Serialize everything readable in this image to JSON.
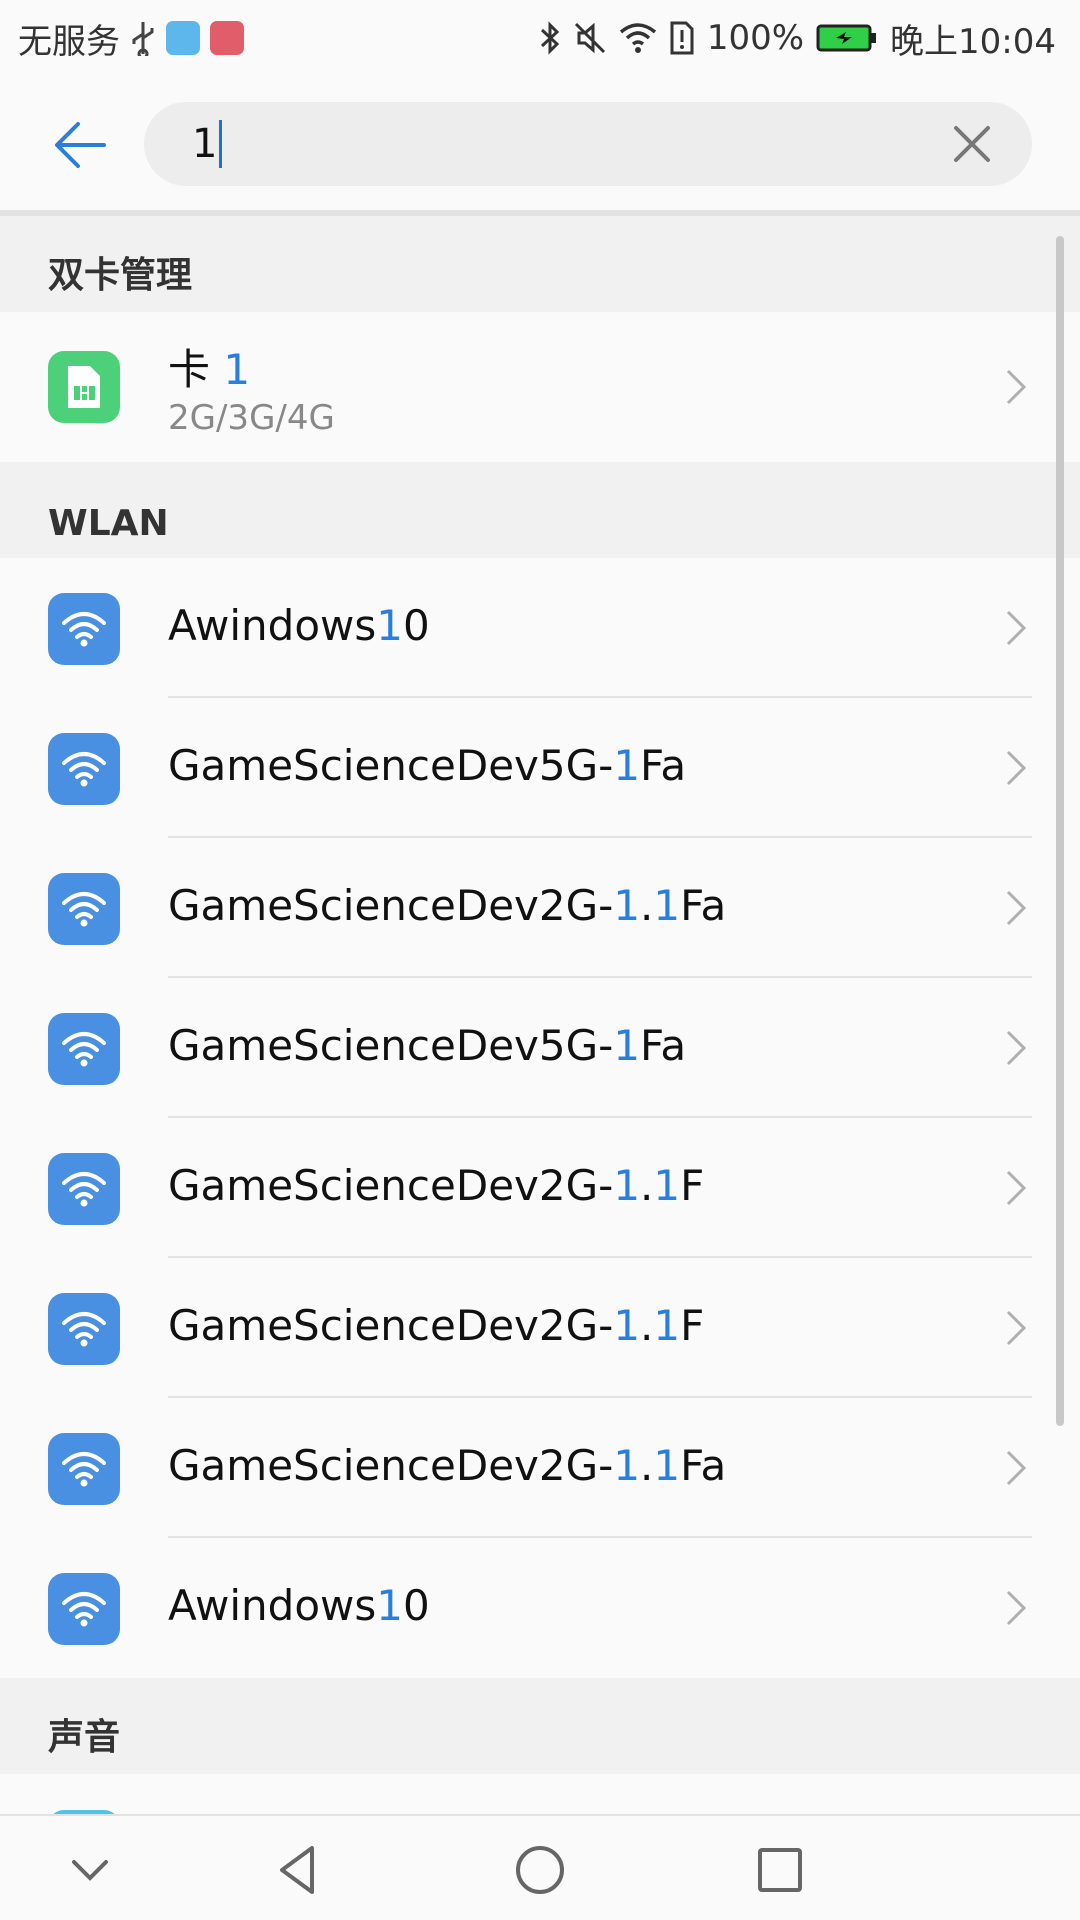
{
  "status_bar": {
    "carrier": "无服务",
    "battery_percent": "100%",
    "time": "晚上10:04",
    "icons": [
      "usb-icon",
      "app-icon-blue",
      "app-icon-red",
      "bluetooth-icon",
      "mute-icon",
      "wifi-icon",
      "sim-alert-icon",
      "battery-charging-icon"
    ]
  },
  "search": {
    "query": "1",
    "back_icon": "arrow-left-icon",
    "clear_icon": "close-icon"
  },
  "sections": {
    "dual_sim": {
      "title": "双卡管理",
      "items": [
        {
          "title_prefix": "卡 ",
          "title_match": "1",
          "subtitle": "2G/3G/4G",
          "icon": "sim-card-icon"
        }
      ]
    },
    "wlan": {
      "title": "WLAN",
      "items": [
        {
          "a": "Awindows",
          "b": "1",
          "c": "0",
          "d": "",
          "e": ""
        },
        {
          "a": "GameScienceDev5G-",
          "b": "1",
          "c": "Fa",
          "d": "",
          "e": ""
        },
        {
          "a": "GameScienceDev2G-",
          "b": "1",
          "c": ".",
          "d": "1",
          "e": "Fa"
        },
        {
          "a": "GameScienceDev5G-",
          "b": "1",
          "c": "Fa",
          "d": "",
          "e": ""
        },
        {
          "a": "GameScienceDev2G-",
          "b": "1",
          "c": ".",
          "d": "1",
          "e": "F"
        },
        {
          "a": "GameScienceDev2G-",
          "b": "1",
          "c": ".",
          "d": "1",
          "e": "F"
        },
        {
          "a": "GameScienceDev2G-",
          "b": "1",
          "c": ".",
          "d": "1",
          "e": "Fa"
        },
        {
          "a": "Awindows",
          "b": "1",
          "c": "0",
          "d": "",
          "e": ""
        }
      ]
    },
    "sound": {
      "title": "声音"
    }
  },
  "nav_bar": {
    "icons": [
      "chevron-down-icon",
      "back-triangle-icon",
      "home-circle-icon",
      "recents-square-icon"
    ]
  },
  "colors": {
    "accent": "#2a7fdc",
    "wifi_icon_bg": "#4a90e2",
    "sim_icon_bg": "#4cd07a"
  }
}
